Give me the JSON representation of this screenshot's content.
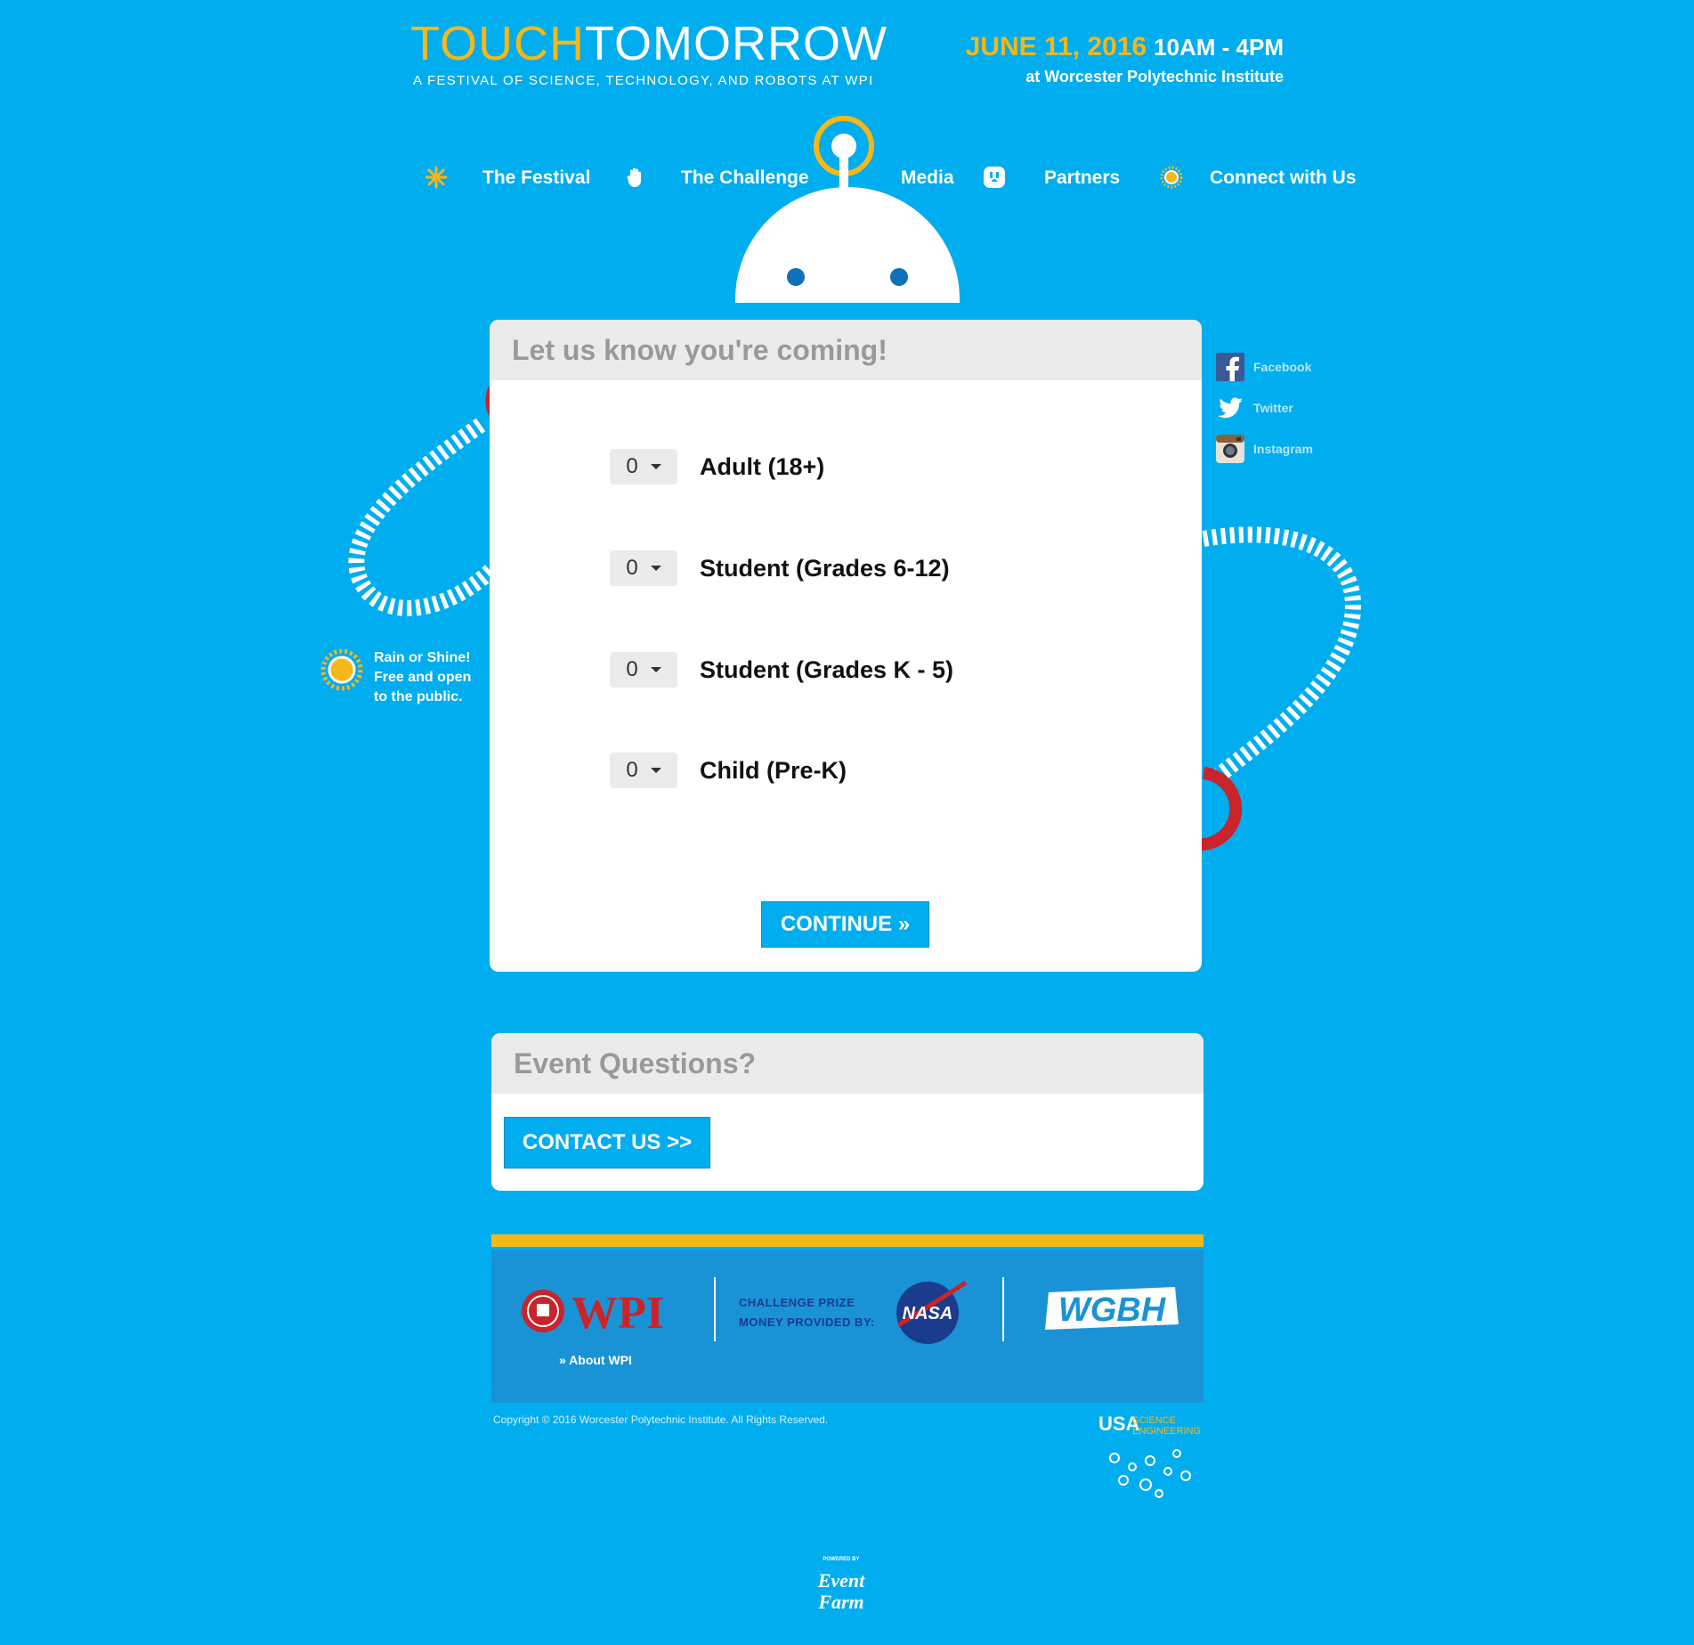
{
  "header": {
    "logo_touch": "TOUCH",
    "logo_tomorrow": "TOMORROW",
    "tagline": "A FESTIVAL OF SCIENCE, TECHNOLOGY, AND ROBOTS AT WPI",
    "date": "JUNE 11, 2016",
    "time": "10AM - 4PM",
    "venue": "at Worcester Polytechnic Institute"
  },
  "nav": {
    "items": [
      {
        "label": "The Festival",
        "icon": "sparkle-icon"
      },
      {
        "label": "The Challenge",
        "icon": "hand-icon"
      },
      {
        "label": "Media",
        "icon": "antenna-robot-icon"
      },
      {
        "label": "Partners",
        "icon": "outlet-icon"
      },
      {
        "label": "Connect with Us",
        "icon": "sun-icon"
      }
    ]
  },
  "rsvp": {
    "title": "Let us know you're coming!",
    "tickets": [
      {
        "qty": "0",
        "label": "Adult (18+)"
      },
      {
        "qty": "0",
        "label": "Student (Grades 6-12)"
      },
      {
        "qty": "0",
        "label": "Student (Grades K - 5)"
      },
      {
        "qty": "0",
        "label": "Child (Pre-K)"
      }
    ],
    "continue_label": "CONTINUE »"
  },
  "questions": {
    "title": "Event Questions?",
    "contact_label": "CONTACT US >>"
  },
  "social": {
    "items": [
      {
        "label": "Facebook",
        "icon": "facebook-icon"
      },
      {
        "label": "Twitter",
        "icon": "twitter-icon"
      },
      {
        "label": "Instagram",
        "icon": "instagram-icon"
      }
    ]
  },
  "note": {
    "line1": "Rain or Shine!",
    "line2": "Free and open",
    "line3": "to the public."
  },
  "footer": {
    "wpi_logo": "WPI",
    "about_wpi": "» About WPI",
    "nasa_caption_line1": "CHALLENGE PRIZE",
    "nasa_caption_line2": "MONEY PROVIDED BY:",
    "nasa_logo": "NASA",
    "wgbh_logo": "WGBH",
    "copyright": "Copyright © 2016 Worcester Polytechnic Institute. All Rights Reserved.",
    "usa_festival_logo": "USA SCIENCE & ENGINEERING FESTIVAL",
    "powered_by": "POWERED BY",
    "eventfarm_logo": "Event Farm"
  },
  "colors": {
    "background": "#00adee",
    "accent_yellow": "#f7b718",
    "magnet_red": "#c9242c",
    "footer_band": "#1a93d6"
  }
}
